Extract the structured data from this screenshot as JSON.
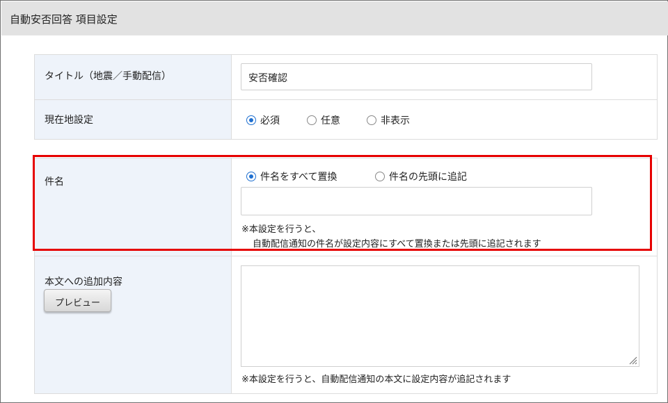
{
  "header": {
    "title": "自動安否回答 項目設定"
  },
  "title_row": {
    "label": "タイトル（地震／手動配信）",
    "value": "安否確認"
  },
  "location_row": {
    "label": "現在地設定",
    "options": [
      {
        "label": "必須",
        "selected": true
      },
      {
        "label": "任意",
        "selected": false
      },
      {
        "label": "非表示",
        "selected": false
      }
    ]
  },
  "subject_row": {
    "label": "件名",
    "options": [
      {
        "label": "件名をすべて置換",
        "selected": true
      },
      {
        "label": "件名の先頭に追記",
        "selected": false
      }
    ],
    "value": "",
    "note_line1": "※本設定を行うと、",
    "note_line2": "自動配信通知の件名が設定内容にすべて置換または先頭に追記されます"
  },
  "body_row": {
    "label": "本文への追加内容",
    "preview_button": "プレビュー",
    "value": "",
    "note": "※本設定を行うと、自動配信通知の本文に設定内容が追記されます"
  },
  "colors": {
    "highlight": "#e60000",
    "radio_selected": "#1e6fd0",
    "label_bg": "#eef3fa"
  }
}
